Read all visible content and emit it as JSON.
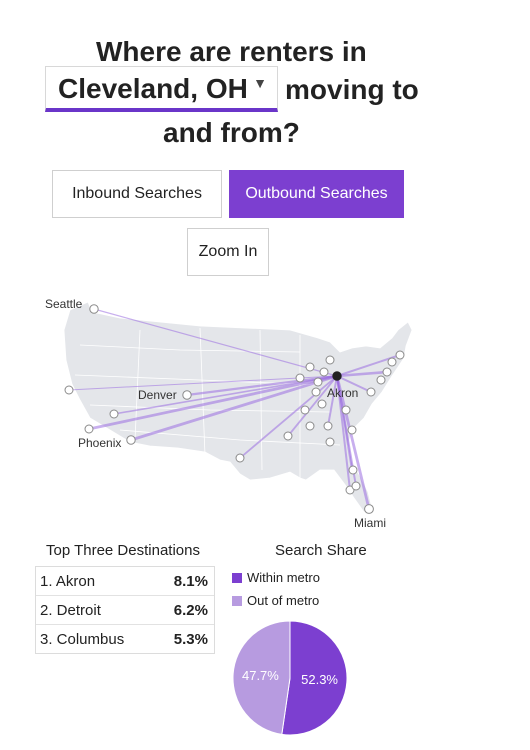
{
  "header": {
    "line1": "Where are renters in",
    "city_value": "Cleveland, OH",
    "line2_suffix": "moving to",
    "line3": "and from?"
  },
  "toggle": {
    "inbound_label": "Inbound Searches",
    "outbound_label": "Outbound Searches",
    "active": "outbound"
  },
  "zoom_label": "Zoom In",
  "map": {
    "labels": {
      "seattle": "Seattle",
      "denver": "Denver",
      "phoenix": "Phoenix",
      "akron": "Akron",
      "miami": "Miami"
    }
  },
  "top_destinations": {
    "title": "Top Three Destinations",
    "rows": [
      {
        "name": "1. Akron",
        "value": "8.1%"
      },
      {
        "name": "2. Detroit",
        "value": "6.2%"
      },
      {
        "name": "3. Columbus",
        "value": "5.3%"
      }
    ]
  },
  "search_share": {
    "title": "Search Share",
    "legend": [
      {
        "label": "Within metro",
        "color": "#7c3fd0"
      },
      {
        "label": "Out of metro",
        "color": "#b79be0"
      }
    ],
    "within_label": "52.3%",
    "out_label": "47.7%"
  },
  "chart_data": {
    "type": "pie",
    "title": "Search Share",
    "categories": [
      "Within metro",
      "Out of metro"
    ],
    "values": [
      52.3,
      47.7
    ]
  },
  "colors": {
    "accent": "#7c3fd0",
    "accent_light": "#b79be0",
    "map_land": "#e4e6ea"
  }
}
